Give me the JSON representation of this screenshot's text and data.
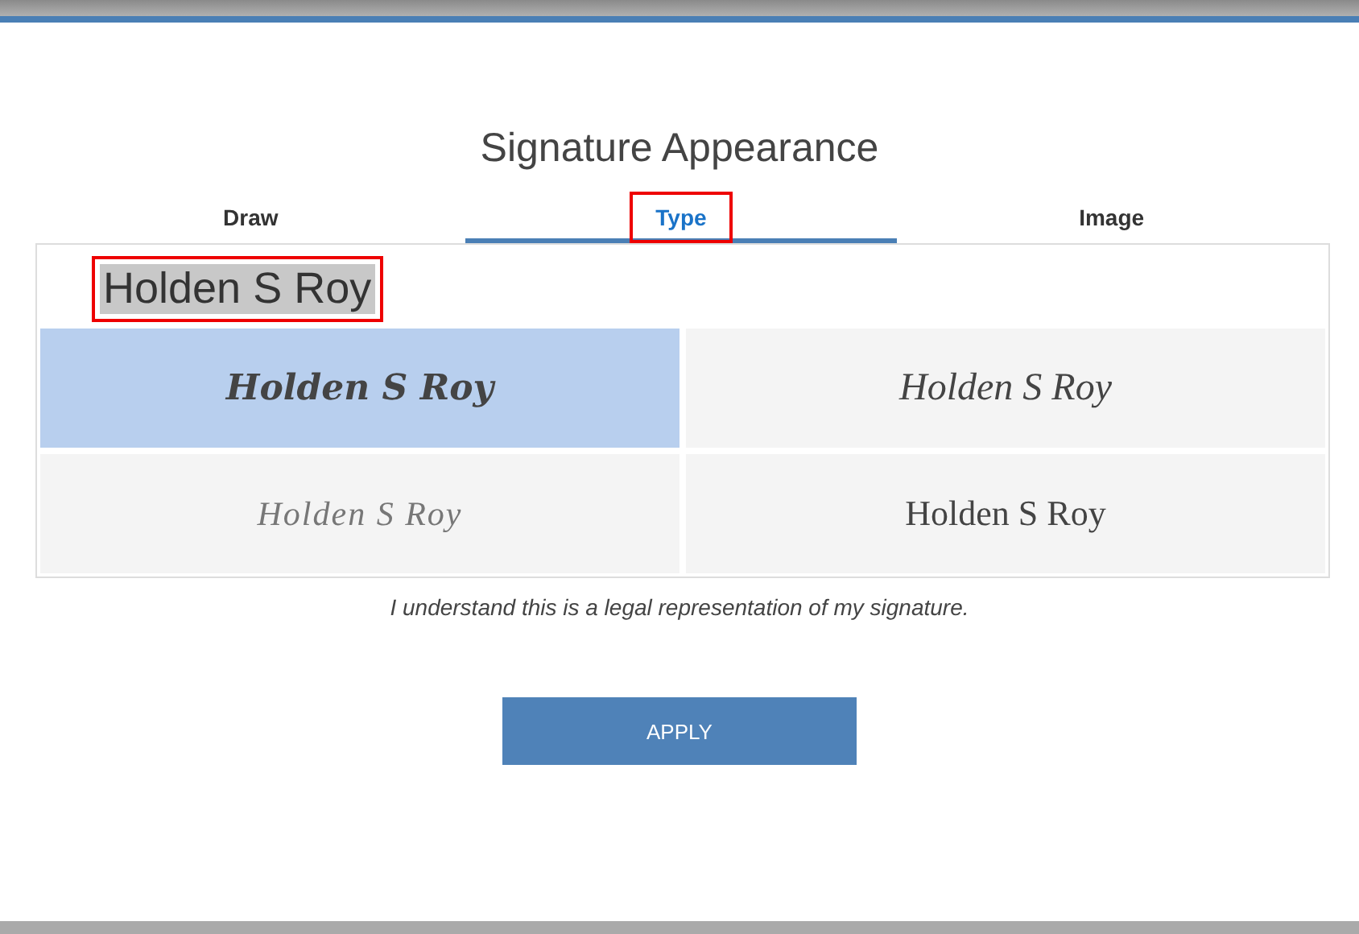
{
  "dialog": {
    "title": "Signature Appearance",
    "tabs": [
      {
        "label": "Draw",
        "selected": false,
        "highlighted": false
      },
      {
        "label": "Type",
        "selected": true,
        "highlighted": true
      },
      {
        "label": "Image",
        "selected": false,
        "highlighted": false
      }
    ],
    "name_field": {
      "value": "Holden S Roy",
      "highlighted": true
    },
    "styles": [
      {
        "kind": "bold-script",
        "text": "Holden S Roy",
        "selected": true
      },
      {
        "kind": "script",
        "text": "Holden S Roy",
        "selected": false
      },
      {
        "kind": "thin-script",
        "text": "Holden S Roy",
        "selected": false
      },
      {
        "kind": "serif",
        "text": "Holden S Roy",
        "selected": false
      }
    ],
    "disclaimer": "I understand this is a legal representation of my signature.",
    "button": "APPLY"
  }
}
